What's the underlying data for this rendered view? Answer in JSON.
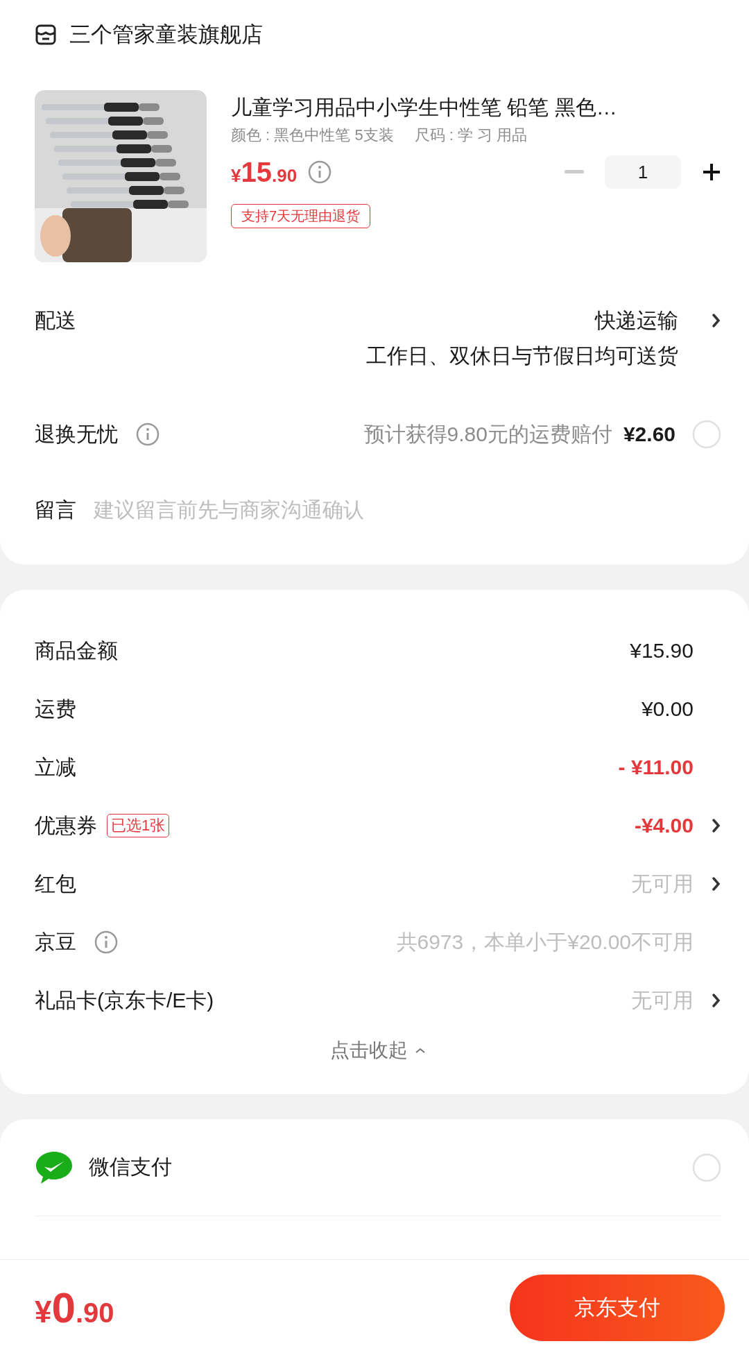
{
  "store": {
    "name": "三个管家童装旗舰店"
  },
  "product": {
    "kind": "picture",
    "title": "儿童学习用品中小学生中性笔 铅笔 黑色…",
    "specs": [
      "颜色 : 黑色中性笔 5支装",
      "尺码 : 学 习 用品"
    ],
    "price": {
      "symbol": "¥",
      "int": "15",
      "dec": ".90"
    },
    "quantity": "1",
    "tag": "支持7天无理由退货"
  },
  "delivery": {
    "label": "配送",
    "method": "快递运输",
    "note": "工作日、双休日与节假日均可送货"
  },
  "return_insurance": {
    "label": "退换无忧",
    "note": "预计获得9.80元的运费赔付",
    "price": "¥2.60",
    "selected": false
  },
  "message": {
    "label": "留言",
    "placeholder": "建议留言前先与商家沟通确认"
  },
  "summary": [
    {
      "kind": "amount",
      "label": "商品金额",
      "value": "¥15.90",
      "arrow": false
    },
    {
      "kind": "amount",
      "label": "运费",
      "value": "¥0.00",
      "arrow": false
    },
    {
      "kind": "discount",
      "label": "立减",
      "value": "- ¥11.00",
      "arrow": false
    },
    {
      "kind": "discount",
      "label": "优惠券",
      "badge": "已选1张",
      "value": "-¥4.00",
      "arrow": true
    },
    {
      "kind": "unavailable",
      "label": "红包",
      "value": "无可用",
      "arrow": true
    },
    {
      "kind": "unavailable",
      "label": "京豆",
      "info": true,
      "value": "共6973，本单小于¥20.00不可用",
      "arrow": false
    },
    {
      "kind": "unavailable",
      "label": "礼品卡(京东卡/E卡)",
      "value": "无可用",
      "arrow": true
    }
  ],
  "collapse": "点击收起",
  "payments": [
    {
      "kind": "wechat",
      "name": "微信支付",
      "selected": false
    }
  ],
  "footer": {
    "total": {
      "symbol": "¥",
      "int": "0",
      "dec": ".90"
    },
    "pay_button": "京东支付"
  }
}
